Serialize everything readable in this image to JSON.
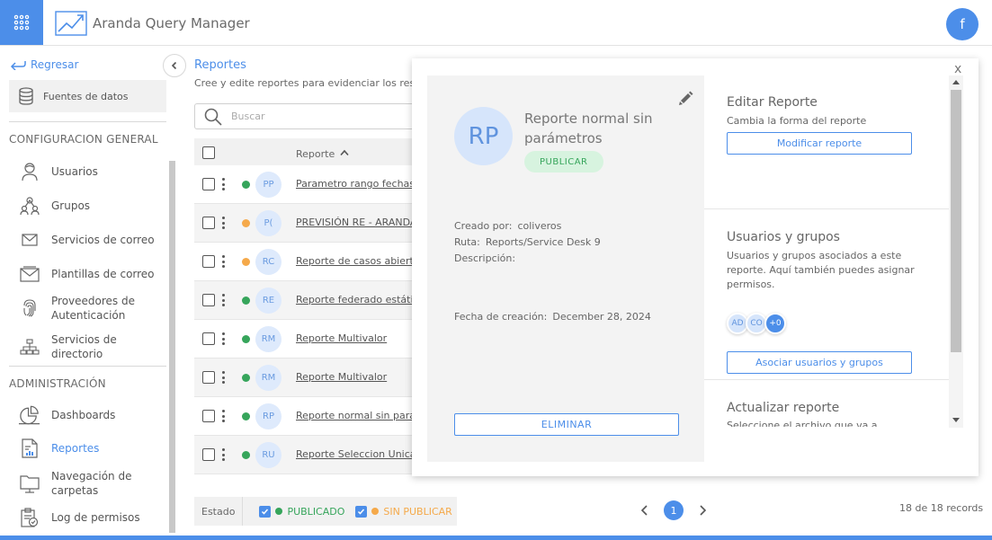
{
  "app": {
    "title": "Aranda Query Manager",
    "user_initial": "f"
  },
  "sidebar": {
    "back_label": "Regresar",
    "datasource_label": "Fuentes de datos",
    "section_general": "CONFIGURACION GENERAL",
    "general_items": [
      {
        "label": "Usuarios",
        "icon": "user-icon"
      },
      {
        "label": "Grupos",
        "icon": "group-icon"
      },
      {
        "label": "Servicios de correo",
        "icon": "mail-icon"
      },
      {
        "label": "Plantillas de correo",
        "icon": "mail-template-icon"
      },
      {
        "label": "Proveedores de Autenticación",
        "icon": "fingerprint-icon"
      },
      {
        "label": "Servicios de directorio",
        "icon": "directory-icon"
      }
    ],
    "section_admin": "ADMINISTRACIÓN",
    "admin_items": [
      {
        "label": "Dashboards",
        "icon": "dashboard-icon"
      },
      {
        "label": "Reportes",
        "icon": "report-icon",
        "active": true
      },
      {
        "label": "Navegación de carpetas",
        "icon": "folder-icon"
      },
      {
        "label": "Log de permisos",
        "icon": "clipboard-check-icon"
      }
    ]
  },
  "main": {
    "title": "Reportes",
    "description": "Cree y edite reportes para evidenciar los resulta",
    "search_placeholder": "Buscar",
    "column_report": "Reporte",
    "rows": [
      {
        "initials": "PP",
        "name": "Parametro rango fechas p",
        "status": "published"
      },
      {
        "initials": "P(",
        "name": "PREVISIÓN RE - ARANDA",
        "status": "unpublished"
      },
      {
        "initials": "RC",
        "name": "Reporte de casos abierto",
        "status": "unpublished"
      },
      {
        "initials": "RE",
        "name": "Reporte federado estátic",
        "status": "published"
      },
      {
        "initials": "RM",
        "name": "Reporte Multivalor",
        "status": "published"
      },
      {
        "initials": "RM",
        "name": "Reporte Multivalor",
        "status": "published"
      },
      {
        "initials": "RP",
        "name": "Reporte normal sin parám",
        "status": "published"
      },
      {
        "initials": "RU",
        "name": "Reporte Seleccion Unica",
        "status": "published"
      }
    ],
    "filter": {
      "label": "Estado",
      "published": "PUBLICADO",
      "unpublished": "SIN PUBLICAR"
    },
    "pagination": {
      "current_page": "1",
      "records": "18 de 18 records"
    }
  },
  "detail": {
    "close": "x",
    "initials": "RP",
    "title": "Reporte normal sin parámetros",
    "badge": "PUBLICAR",
    "created_by_label": "Creado por:",
    "created_by": "coliveros",
    "route_label": "Ruta:",
    "route": "Reports/Service Desk 9",
    "description_label": "Descripción:",
    "creation_date_label": "Fecha de creación:",
    "creation_date": "December 28, 2024",
    "delete_label": "ELIMINAR",
    "edit_title": "Editar Reporte",
    "edit_desc": "Cambia la forma del reporte",
    "edit_button": "Modificar reporte",
    "users_title": "Usuarios y grupos",
    "users_desc": "Usuarios y grupos asociados a este reporte. Aquí también puedes asignar permisos.",
    "assoc_avatars": [
      "AD",
      "CO",
      "+0"
    ],
    "users_button": "Asociar usuarios y grupos",
    "update_title": "Actualizar reporte",
    "update_desc": "Seleccione el archivo que va a"
  },
  "colors": {
    "accent": "#4c8ee9",
    "published": "#36a55b",
    "unpublished": "#f5a94a"
  }
}
